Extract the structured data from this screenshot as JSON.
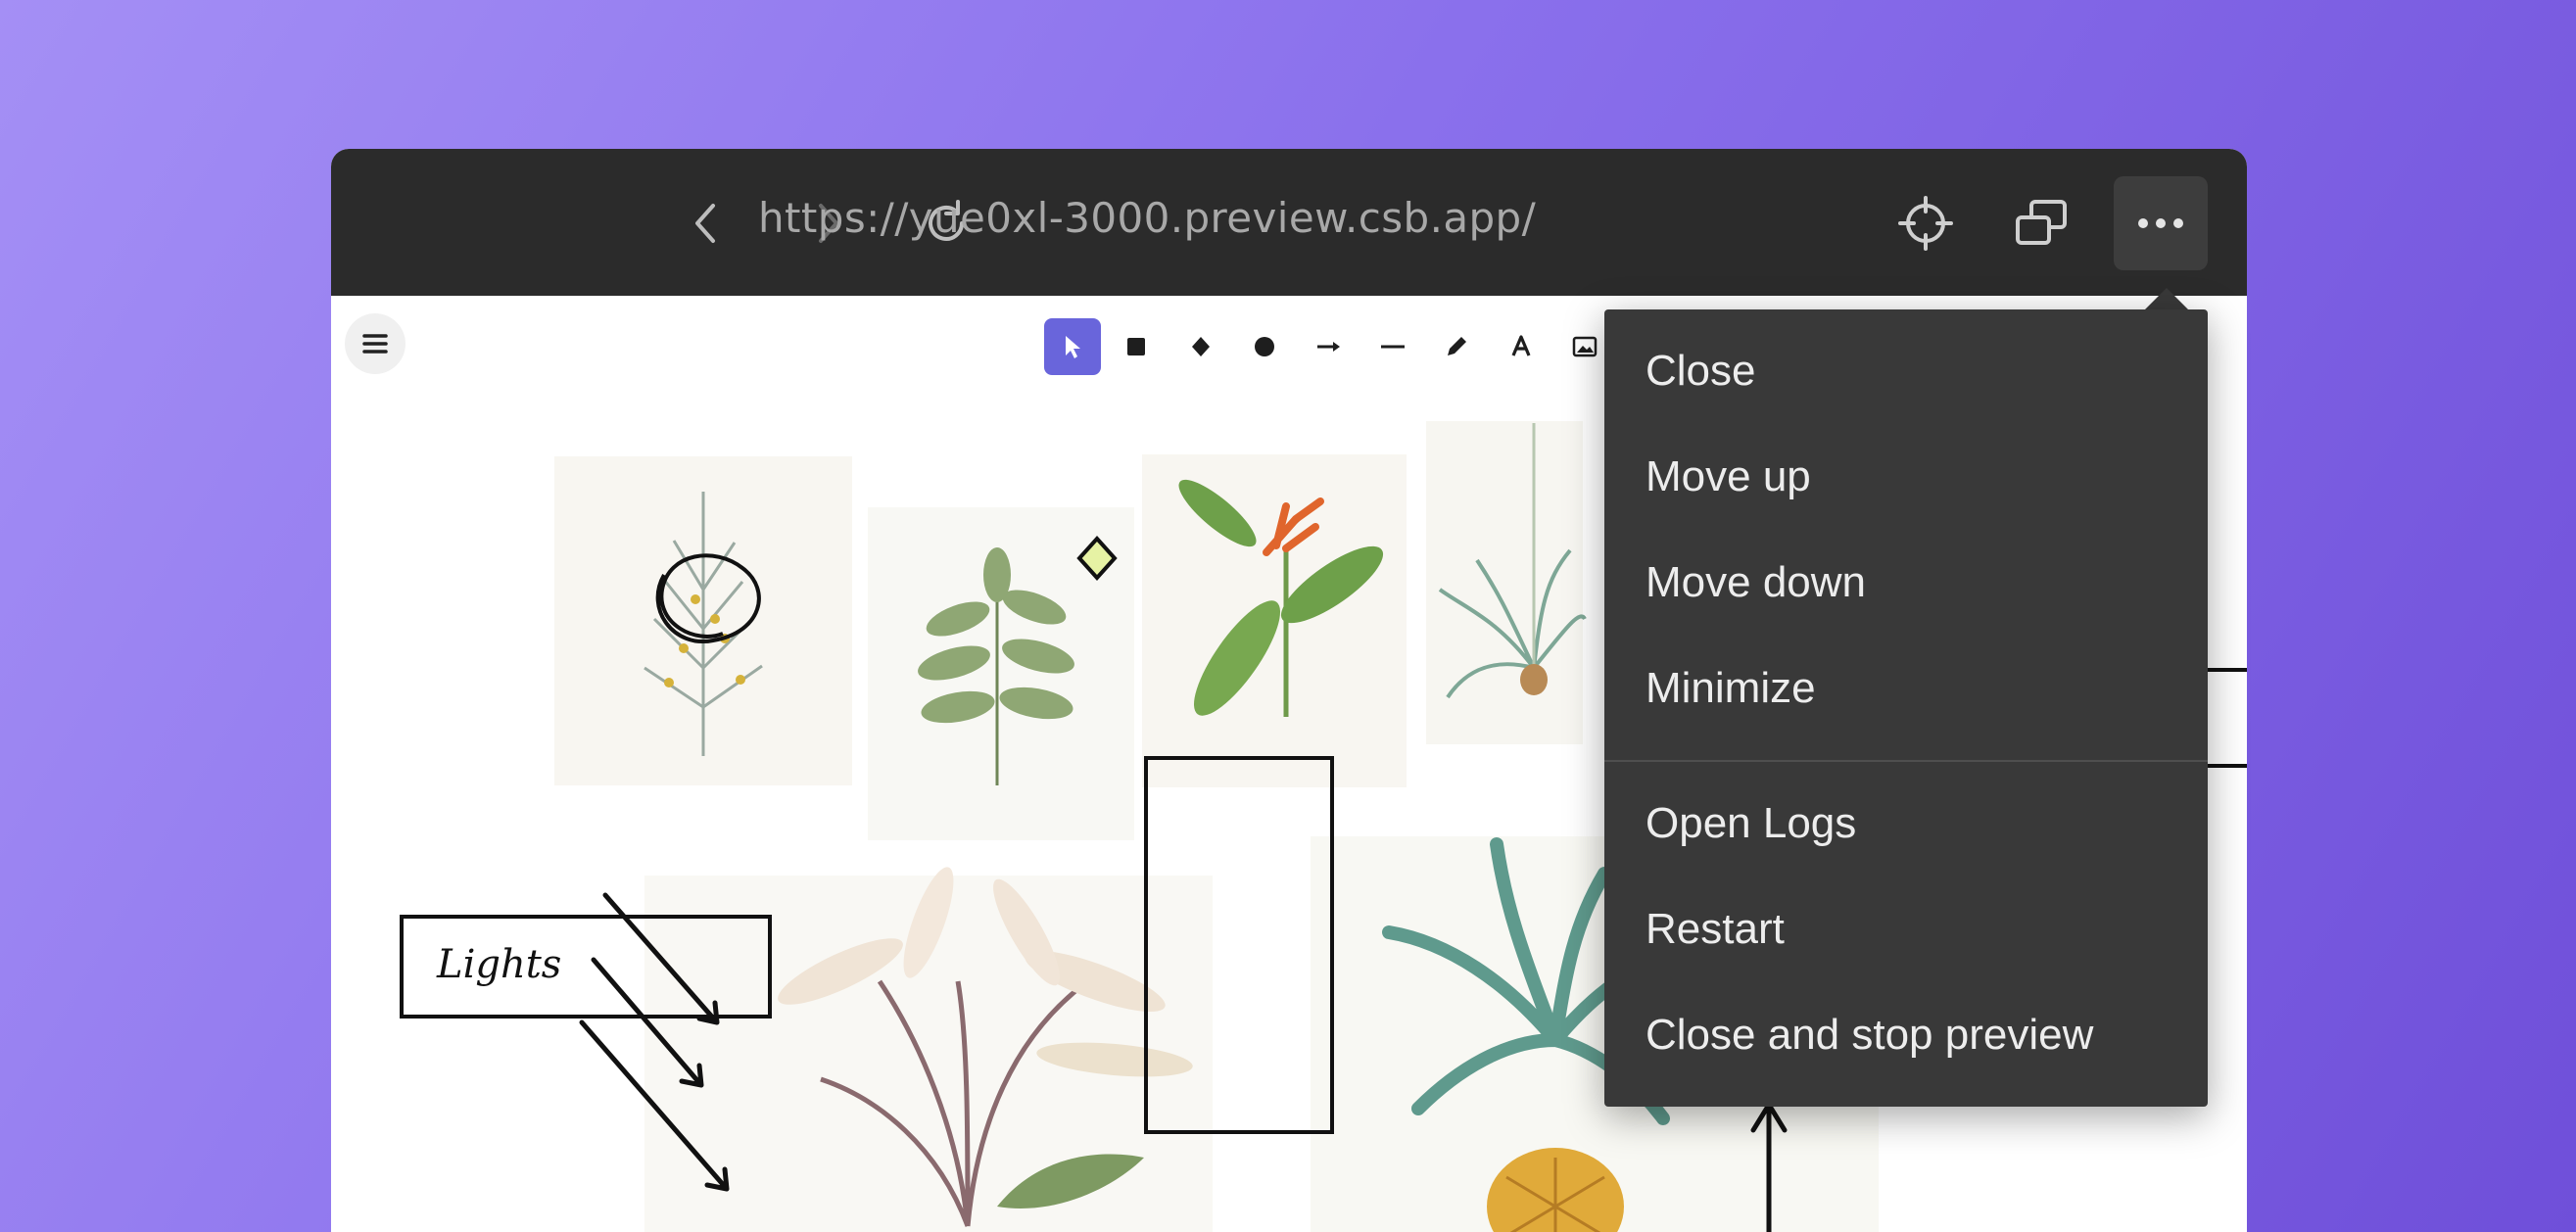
{
  "browser": {
    "url": "https://yue0xl-3000.preview.csb.app/",
    "buttons": [
      "back-icon",
      "forward-icon",
      "reload-icon",
      "crosshair-icon",
      "windows-icon",
      "more-icon"
    ]
  },
  "toolbar": {
    "tools": [
      "select-icon",
      "rectangle-icon",
      "diamond-icon",
      "ellipse-icon",
      "arrow-icon",
      "line-icon",
      "pencil-icon",
      "text-icon",
      "image-icon"
    ],
    "active_tool": "select-icon",
    "accent": "#6965db"
  },
  "canvas": {
    "label_text": "Lights"
  },
  "menu": {
    "items": [
      "Close",
      "Move up",
      "Move down",
      "Minimize",
      "Open Logs",
      "Restart",
      "Close and stop preview"
    ]
  }
}
